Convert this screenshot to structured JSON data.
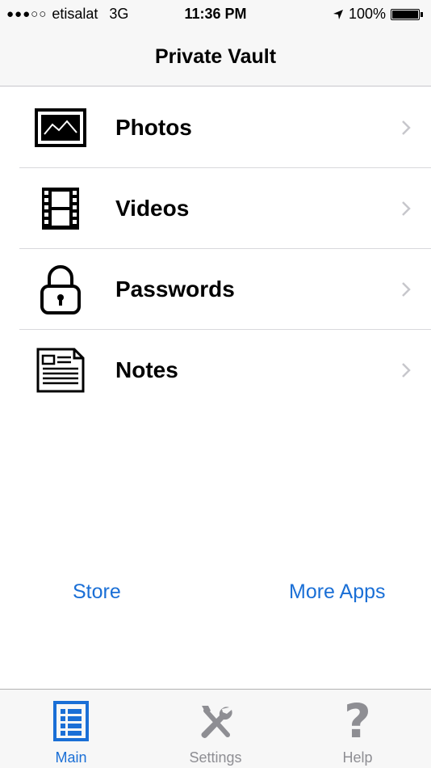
{
  "status_bar": {
    "signal": "●●●○○",
    "carrier": "etisalat",
    "network": "3G",
    "time": "11:36 PM",
    "battery": "100%"
  },
  "nav": {
    "title": "Private Vault"
  },
  "list": {
    "items": [
      {
        "label": "Photos",
        "icon": "photo-icon"
      },
      {
        "label": "Videos",
        "icon": "film-icon"
      },
      {
        "label": "Passwords",
        "icon": "lock-icon"
      },
      {
        "label": "Notes",
        "icon": "note-icon"
      }
    ]
  },
  "links": {
    "store": "Store",
    "more_apps": "More Apps"
  },
  "tab_bar": {
    "tabs": [
      {
        "label": "Main",
        "icon": "list-grid-icon",
        "selected": true
      },
      {
        "label": "Settings",
        "icon": "tools-icon",
        "selected": false
      },
      {
        "label": "Help",
        "icon": "question-icon",
        "selected": false
      }
    ],
    "help_glyph": "?"
  },
  "colors": {
    "accent": "#1a6fd6",
    "inactive": "#8e8e93",
    "bar_background": "#f7f7f7"
  }
}
